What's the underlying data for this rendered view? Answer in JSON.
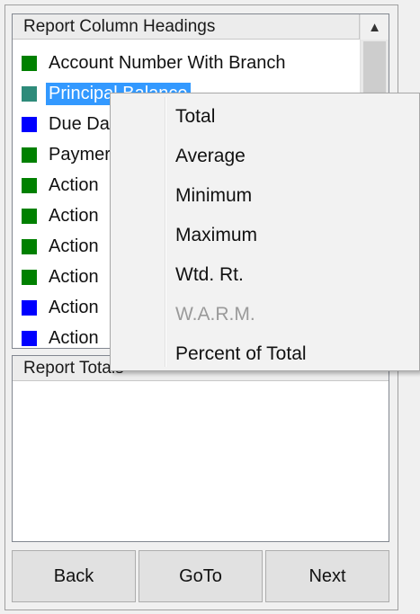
{
  "list": {
    "header": "Report Column Headings",
    "items": [
      {
        "label": "Account Number With Branch",
        "color": "#008000"
      },
      {
        "label": "Principal Balance",
        "color": "#2e8b7a",
        "selected": true
      },
      {
        "label": "Due Da",
        "color": "#0000ff"
      },
      {
        "label": "Paymer",
        "color": "#008000"
      },
      {
        "label": "Action",
        "color": "#008000"
      },
      {
        "label": "Action",
        "color": "#008000"
      },
      {
        "label": "Action",
        "color": "#008000"
      },
      {
        "label": "Action",
        "color": "#008000"
      },
      {
        "label": "Action",
        "color": "#0000ff"
      },
      {
        "label": "Action",
        "color": "#0000ff"
      }
    ]
  },
  "totals": {
    "header": "Report Totals"
  },
  "nav": {
    "back": "Back",
    "goto": "GoTo",
    "next": "Next"
  },
  "context_menu": {
    "items": [
      {
        "label": "Total",
        "enabled": true
      },
      {
        "label": "Average",
        "enabled": true
      },
      {
        "label": "Minimum",
        "enabled": true
      },
      {
        "label": "Maximum",
        "enabled": true
      },
      {
        "label": "Wtd. Rt.",
        "enabled": true
      },
      {
        "label": "W.A.R.M.",
        "enabled": false
      },
      {
        "label": "Percent of Total",
        "enabled": true
      }
    ]
  }
}
